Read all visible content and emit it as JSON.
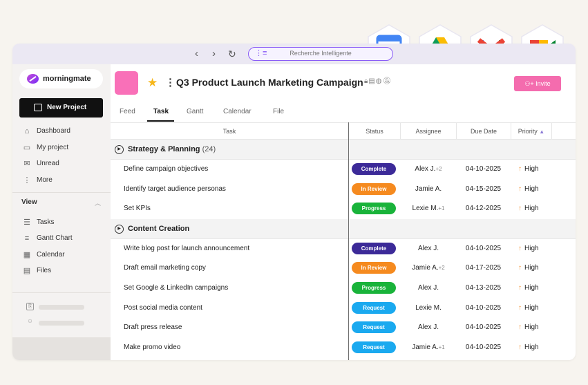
{
  "browser": {
    "search_placeholder": "Recherche Intelligente",
    "back_icon": "‹",
    "forward_icon": "›",
    "reload_icon": "↻"
  },
  "sidebar": {
    "logo_text": "morningmate",
    "new_project_label": "New Project",
    "nav_items": [
      {
        "icon": "home-icon",
        "label": "Dashboard"
      },
      {
        "icon": "project-icon",
        "label": "My project"
      },
      {
        "icon": "mail-icon",
        "label": "Unread"
      },
      {
        "icon": "more-vertical-icon",
        "label": "More"
      }
    ],
    "view_heading": "View",
    "view_items": [
      {
        "icon": "list-icon",
        "label": "Tasks"
      },
      {
        "icon": "gantt-icon",
        "label": "Gantt Chart"
      },
      {
        "icon": "calendar-icon",
        "label": "Calendar"
      },
      {
        "icon": "files-icon",
        "label": "Files"
      }
    ]
  },
  "project": {
    "title": "Q3 Product Launch Marketing Campaign",
    "invite_label": "+ Invite",
    "tabs": [
      "Feed",
      "Task",
      "Gantt",
      "Calendar",
      "File"
    ],
    "active_tab": "Task"
  },
  "table": {
    "columns": [
      "Task",
      "Status",
      "Assignee",
      "Due Date",
      "Priority"
    ],
    "sort_indicator": "▲",
    "groups": [
      {
        "name": "Strategy & Planning",
        "count": "(24)",
        "tasks": [
          {
            "name": "Define campaign objectives",
            "status": "Complete",
            "assignee": "Alex J.",
            "more": "+2",
            "due": "04-10-2025",
            "priority": "High"
          },
          {
            "name": "Identify target audience personas",
            "status": "In Review",
            "assignee": "Jamie A.",
            "more": "",
            "due": "04-15-2025",
            "priority": "High"
          },
          {
            "name": "Set KPIs",
            "status": "Progress",
            "assignee": "Lexie M.",
            "more": "+1",
            "due": "04-12-2025",
            "priority": "High"
          }
        ]
      },
      {
        "name": "Content Creation",
        "count": "",
        "tasks": [
          {
            "name": "Write blog post for launch announcement",
            "status": "Complete",
            "assignee": "Alex J.",
            "more": "",
            "due": "04-10-2025",
            "priority": "High"
          },
          {
            "name": "Draft email marketing copy",
            "status": "In Review",
            "assignee": "Jamie A.",
            "more": "+2",
            "due": "04-17-2025",
            "priority": "High"
          },
          {
            "name": "Set Google & LinkedIn campaigns",
            "status": "Progress",
            "assignee": "Alex J.",
            "more": "",
            "due": "04-13-2025",
            "priority": "High"
          },
          {
            "name": "Post social media content",
            "status": "Request",
            "assignee": "Lexie M.",
            "more": "",
            "due": "04-10-2025",
            "priority": "High"
          },
          {
            "name": "Draft press release",
            "status": "Request",
            "assignee": "Alex J.",
            "more": "",
            "due": "04-10-2025",
            "priority": "High"
          },
          {
            "name": "Make promo video",
            "status": "Request",
            "assignee": "Jamie A.",
            "more": "+1",
            "due": "04-10-2025",
            "priority": "High"
          }
        ]
      }
    ]
  },
  "status_colors": {
    "Complete": "#3c2a98",
    "In Review": "#f58a1f",
    "Progress": "#19b33a",
    "Request": "#1aa9ef"
  },
  "integrations": [
    {
      "icon": "google-calendar-icon",
      "label": "31"
    },
    {
      "icon": "google-drive-icon",
      "label": ""
    },
    {
      "icon": "gmail-icon",
      "label": ""
    },
    {
      "icon": "google-meet-icon",
      "label": ""
    }
  ]
}
